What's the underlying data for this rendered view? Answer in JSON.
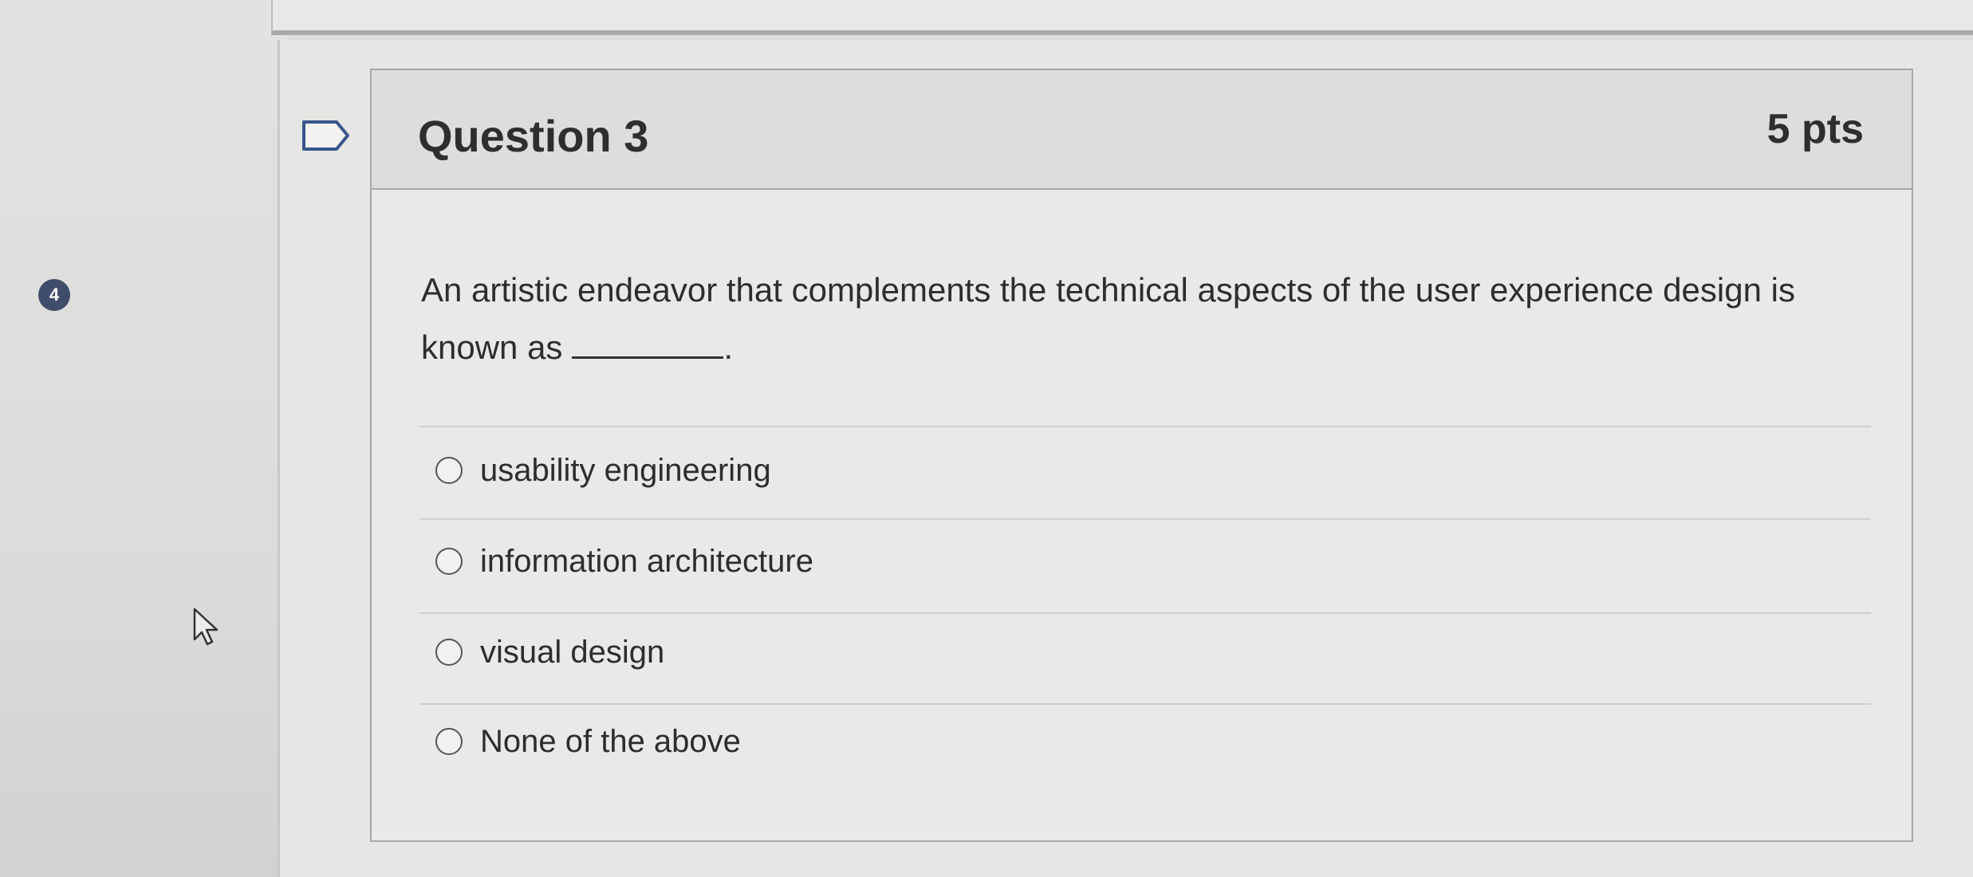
{
  "sidebar": {
    "question_badge": "4"
  },
  "question": {
    "title": "Question 3",
    "points": "5 pts",
    "prompt_part1": "An artistic endeavor that complements the technical aspects of the user experience design is known as",
    "prompt_part2": ".",
    "answers": [
      {
        "label": "usability engineering",
        "selected": false
      },
      {
        "label": "information architecture",
        "selected": false
      },
      {
        "label": "visual design",
        "selected": false
      },
      {
        "label": "None of the above",
        "selected": false
      }
    ]
  },
  "icons": {
    "bookmark": "flag-bookmark-icon",
    "cursor": "mouse-pointer-icon"
  }
}
